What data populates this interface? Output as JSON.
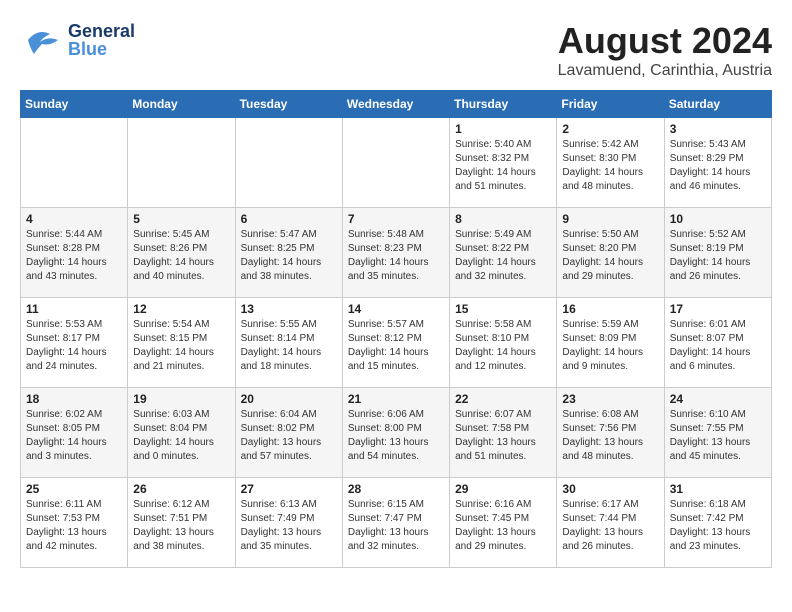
{
  "header": {
    "logo_general": "General",
    "logo_blue": "Blue",
    "month_year": "August 2024",
    "location": "Lavamuend, Carinthia, Austria"
  },
  "weekdays": [
    "Sunday",
    "Monday",
    "Tuesday",
    "Wednesday",
    "Thursday",
    "Friday",
    "Saturday"
  ],
  "weeks": [
    [
      {
        "day": "",
        "info": ""
      },
      {
        "day": "",
        "info": ""
      },
      {
        "day": "",
        "info": ""
      },
      {
        "day": "",
        "info": ""
      },
      {
        "day": "1",
        "info": "Sunrise: 5:40 AM\nSunset: 8:32 PM\nDaylight: 14 hours\nand 51 minutes."
      },
      {
        "day": "2",
        "info": "Sunrise: 5:42 AM\nSunset: 8:30 PM\nDaylight: 14 hours\nand 48 minutes."
      },
      {
        "day": "3",
        "info": "Sunrise: 5:43 AM\nSunset: 8:29 PM\nDaylight: 14 hours\nand 46 minutes."
      }
    ],
    [
      {
        "day": "4",
        "info": "Sunrise: 5:44 AM\nSunset: 8:28 PM\nDaylight: 14 hours\nand 43 minutes."
      },
      {
        "day": "5",
        "info": "Sunrise: 5:45 AM\nSunset: 8:26 PM\nDaylight: 14 hours\nand 40 minutes."
      },
      {
        "day": "6",
        "info": "Sunrise: 5:47 AM\nSunset: 8:25 PM\nDaylight: 14 hours\nand 38 minutes."
      },
      {
        "day": "7",
        "info": "Sunrise: 5:48 AM\nSunset: 8:23 PM\nDaylight: 14 hours\nand 35 minutes."
      },
      {
        "day": "8",
        "info": "Sunrise: 5:49 AM\nSunset: 8:22 PM\nDaylight: 14 hours\nand 32 minutes."
      },
      {
        "day": "9",
        "info": "Sunrise: 5:50 AM\nSunset: 8:20 PM\nDaylight: 14 hours\nand 29 minutes."
      },
      {
        "day": "10",
        "info": "Sunrise: 5:52 AM\nSunset: 8:19 PM\nDaylight: 14 hours\nand 26 minutes."
      }
    ],
    [
      {
        "day": "11",
        "info": "Sunrise: 5:53 AM\nSunset: 8:17 PM\nDaylight: 14 hours\nand 24 minutes."
      },
      {
        "day": "12",
        "info": "Sunrise: 5:54 AM\nSunset: 8:15 PM\nDaylight: 14 hours\nand 21 minutes."
      },
      {
        "day": "13",
        "info": "Sunrise: 5:55 AM\nSunset: 8:14 PM\nDaylight: 14 hours\nand 18 minutes."
      },
      {
        "day": "14",
        "info": "Sunrise: 5:57 AM\nSunset: 8:12 PM\nDaylight: 14 hours\nand 15 minutes."
      },
      {
        "day": "15",
        "info": "Sunrise: 5:58 AM\nSunset: 8:10 PM\nDaylight: 14 hours\nand 12 minutes."
      },
      {
        "day": "16",
        "info": "Sunrise: 5:59 AM\nSunset: 8:09 PM\nDaylight: 14 hours\nand 9 minutes."
      },
      {
        "day": "17",
        "info": "Sunrise: 6:01 AM\nSunset: 8:07 PM\nDaylight: 14 hours\nand 6 minutes."
      }
    ],
    [
      {
        "day": "18",
        "info": "Sunrise: 6:02 AM\nSunset: 8:05 PM\nDaylight: 14 hours\nand 3 minutes."
      },
      {
        "day": "19",
        "info": "Sunrise: 6:03 AM\nSunset: 8:04 PM\nDaylight: 14 hours\nand 0 minutes."
      },
      {
        "day": "20",
        "info": "Sunrise: 6:04 AM\nSunset: 8:02 PM\nDaylight: 13 hours\nand 57 minutes."
      },
      {
        "day": "21",
        "info": "Sunrise: 6:06 AM\nSunset: 8:00 PM\nDaylight: 13 hours\nand 54 minutes."
      },
      {
        "day": "22",
        "info": "Sunrise: 6:07 AM\nSunset: 7:58 PM\nDaylight: 13 hours\nand 51 minutes."
      },
      {
        "day": "23",
        "info": "Sunrise: 6:08 AM\nSunset: 7:56 PM\nDaylight: 13 hours\nand 48 minutes."
      },
      {
        "day": "24",
        "info": "Sunrise: 6:10 AM\nSunset: 7:55 PM\nDaylight: 13 hours\nand 45 minutes."
      }
    ],
    [
      {
        "day": "25",
        "info": "Sunrise: 6:11 AM\nSunset: 7:53 PM\nDaylight: 13 hours\nand 42 minutes."
      },
      {
        "day": "26",
        "info": "Sunrise: 6:12 AM\nSunset: 7:51 PM\nDaylight: 13 hours\nand 38 minutes."
      },
      {
        "day": "27",
        "info": "Sunrise: 6:13 AM\nSunset: 7:49 PM\nDaylight: 13 hours\nand 35 minutes."
      },
      {
        "day": "28",
        "info": "Sunrise: 6:15 AM\nSunset: 7:47 PM\nDaylight: 13 hours\nand 32 minutes."
      },
      {
        "day": "29",
        "info": "Sunrise: 6:16 AM\nSunset: 7:45 PM\nDaylight: 13 hours\nand 29 minutes."
      },
      {
        "day": "30",
        "info": "Sunrise: 6:17 AM\nSunset: 7:44 PM\nDaylight: 13 hours\nand 26 minutes."
      },
      {
        "day": "31",
        "info": "Sunrise: 6:18 AM\nSunset: 7:42 PM\nDaylight: 13 hours\nand 23 minutes."
      }
    ]
  ]
}
